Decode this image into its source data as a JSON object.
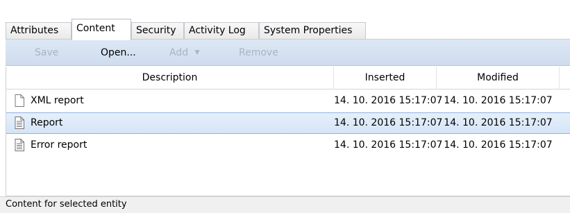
{
  "tabs": [
    {
      "label": "Attributes",
      "active": false
    },
    {
      "label": "Content",
      "active": true
    },
    {
      "label": "Security",
      "active": false
    },
    {
      "label": "Activity Log",
      "active": false
    },
    {
      "label": "System Properties",
      "active": false
    }
  ],
  "toolbar": {
    "save_label": "Save",
    "open_label": "Open...",
    "add_label": "Add",
    "add_arrow": "▼",
    "remove_label": "Remove"
  },
  "grid": {
    "columns": [
      "Description",
      "Inserted",
      "Modified"
    ],
    "rows": [
      {
        "icon": "blank-document-icon",
        "description": "XML report",
        "inserted": "14. 10. 2016 15:17:07",
        "modified": "14. 10. 2016 15:17:07",
        "selected": false
      },
      {
        "icon": "text-document-icon",
        "description": "Report",
        "inserted": "14. 10. 2016 15:17:07",
        "modified": "14. 10. 2016 15:17:07",
        "selected": true
      },
      {
        "icon": "text-document-icon",
        "description": "Error report",
        "inserted": "14. 10. 2016 15:17:07",
        "modified": "14. 10. 2016 15:17:07",
        "selected": false
      }
    ]
  },
  "status": {
    "text": "Content for selected entity"
  },
  "colors": {
    "toolbar_bg": "#d4e1f1",
    "selection_bg": "#d9e7f8",
    "selection_border": "#8fb2df",
    "disabled_text": "#a9b3c2"
  }
}
